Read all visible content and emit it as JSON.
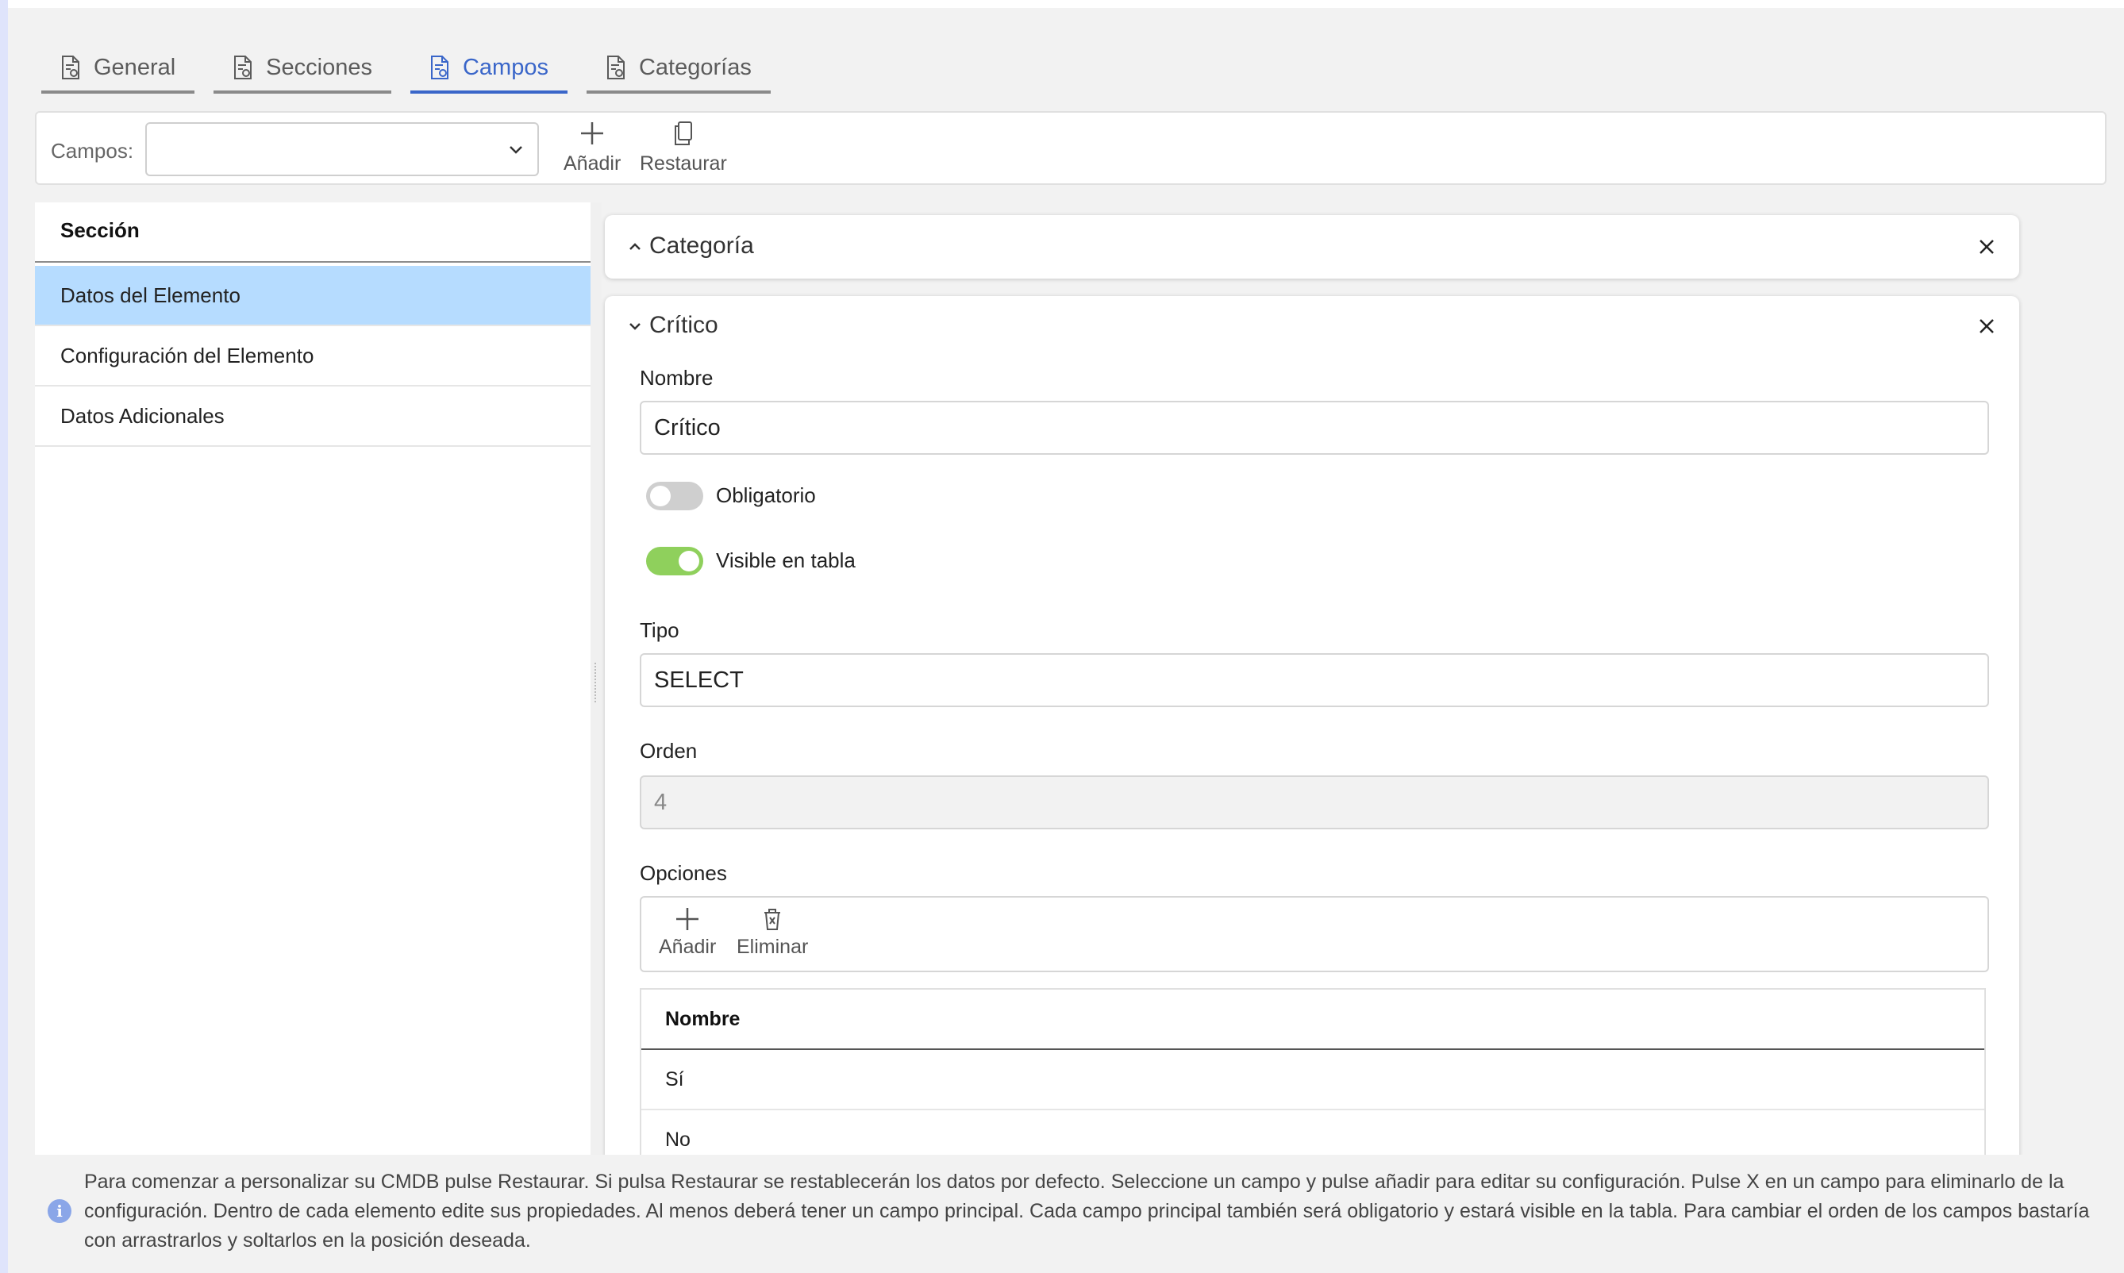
{
  "tabs": [
    {
      "label": "General",
      "active": false
    },
    {
      "label": "Secciones",
      "active": false
    },
    {
      "label": "Campos",
      "active": true
    },
    {
      "label": "Categorías",
      "active": false
    }
  ],
  "toolbar": {
    "campos_label": "Campos:",
    "campos_value": "",
    "add_label": "Añadir",
    "restore_label": "Restaurar"
  },
  "sections": {
    "header": "Sección",
    "items": [
      {
        "label": "Datos del Elemento",
        "selected": true
      },
      {
        "label": "Configuración del Elemento",
        "selected": false
      },
      {
        "label": "Datos Adicionales",
        "selected": false
      }
    ]
  },
  "cards": {
    "categoria": {
      "title": "Categoría",
      "expanded": false
    },
    "critico": {
      "title": "Crítico",
      "expanded": true,
      "nombre_label": "Nombre",
      "nombre_value": "Crítico",
      "obligatorio_label": "Obligatorio",
      "obligatorio_on": false,
      "visible_label": "Visible en tabla",
      "visible_on": true,
      "tipo_label": "Tipo",
      "tipo_value": "SELECT",
      "orden_label": "Orden",
      "orden_value": "4",
      "opciones_label": "Opciones",
      "opciones_add_label": "Añadir",
      "opciones_delete_label": "Eliminar",
      "opciones_table": {
        "header": "Nombre",
        "rows": [
          "Sí",
          "No"
        ]
      }
    }
  },
  "info": {
    "text": "Para comenzar a personalizar su CMDB pulse Restaurar. Si pulsa Restaurar se restablecerán los datos por defecto. Seleccione un campo y pulse añadir para editar su configuración. Pulse X en un campo para eliminarlo de la configuración. Dentro de cada elemento edite sus propiedades. Al menos deberá tener un campo principal. Cada campo principal también será obligatorio y estará visible en la tabla. Para cambiar el orden de los campos bastaría con arrastrarlos y soltarlos en la posición deseada."
  },
  "colors": {
    "accent": "#3a66c9",
    "selected_row": "#b6dcff",
    "toggle_on": "#8fd05c",
    "toggle_off": "#cfcfcf"
  }
}
